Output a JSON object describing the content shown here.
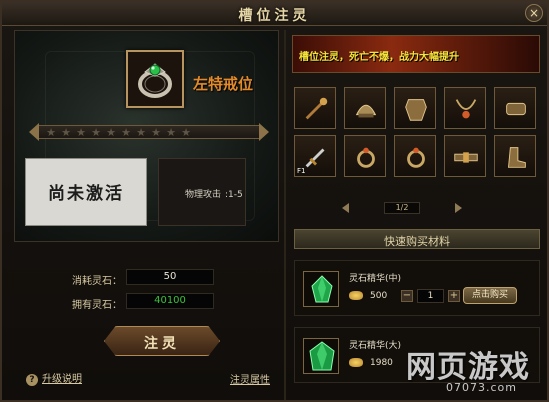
{
  "window": {
    "title": "槽位注灵",
    "close_glyph": "×"
  },
  "slot": {
    "name": "左特戒位",
    "icon": "ring-icon"
  },
  "stars": {
    "count": 10,
    "filled": 0
  },
  "status": {
    "text": "尚未激活"
  },
  "attribute": {
    "label": "物理攻击",
    "value": ":1-5"
  },
  "cost": {
    "consume_label": "消耗灵石：",
    "consume_value": "50",
    "own_label": "拥有灵石：",
    "own_value": "40100"
  },
  "inject_button": "注灵",
  "links": {
    "help": "升级说明",
    "help_glyph": "?",
    "attributes": "注灵属性"
  },
  "banner": {
    "text": "槽位注灵，死亡不爆，战力大幅提升"
  },
  "equipment_slots": [
    {
      "name": "staff-icon"
    },
    {
      "name": "helmet-icon"
    },
    {
      "name": "armor-icon"
    },
    {
      "name": "necklace-icon"
    },
    {
      "name": "bracer-icon"
    },
    {
      "name": "weapon-icon",
      "badge": "F1"
    },
    {
      "name": "ring-icon"
    },
    {
      "name": "ring-icon"
    },
    {
      "name": "belt-icon"
    },
    {
      "name": "boots-icon"
    }
  ],
  "pager": {
    "text": "1/2"
  },
  "shop": {
    "header": "快速购买材料",
    "items": [
      {
        "name": "灵石精华(中)",
        "price": "500",
        "quantity": "1",
        "buy": "点击购买"
      },
      {
        "name": "灵石精华(大)",
        "price": "1980"
      }
    ]
  },
  "watermark": {
    "main": "网页游戏",
    "sub": "07073.com"
  },
  "colors": {
    "accent": "#e38a2a",
    "banner_text": "#f5e23a",
    "own_value": "#3cc23c"
  }
}
